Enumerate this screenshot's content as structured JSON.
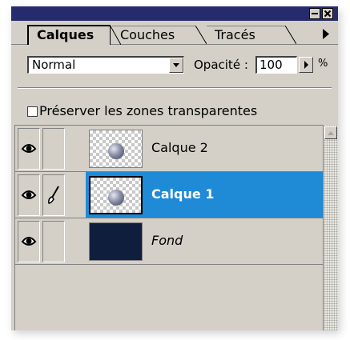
{
  "tabs": [
    {
      "label": "Calques",
      "active": true
    },
    {
      "label": "Couches",
      "active": false
    },
    {
      "label": "Tracés",
      "active": false
    }
  ],
  "blend_mode": {
    "value": "Normal"
  },
  "opacity": {
    "label": "Opacité :",
    "value": "100",
    "unit": "%"
  },
  "preserve_transparency": {
    "label": "Préserver les zones transparentes",
    "checked": false
  },
  "layers": [
    {
      "name": "Calque 2",
      "visible": true,
      "editing": false,
      "selected": false,
      "thumbnail": "transparent-with-sphere"
    },
    {
      "name": "Calque 1",
      "visible": true,
      "editing": true,
      "selected": true,
      "thumbnail": "transparent-with-sphere"
    },
    {
      "name": "Fond",
      "visible": true,
      "editing": false,
      "selected": false,
      "thumbnail": "solid-dark-navy"
    }
  ],
  "icons": {
    "eye": "eye-icon",
    "brush": "paintbrush-icon",
    "minimize": "minimize-icon",
    "close": "close-icon",
    "menu": "panel-menu-arrow-icon",
    "dropdown": "dropdown-arrow-icon",
    "scroll_up": "scroll-up-arrow-icon"
  },
  "colors": {
    "title_bar": "#262b6e",
    "panel_bg": "#d4d0c8",
    "selected_row": "#1f8ad6",
    "fond_fill": "#0f1e3c"
  }
}
